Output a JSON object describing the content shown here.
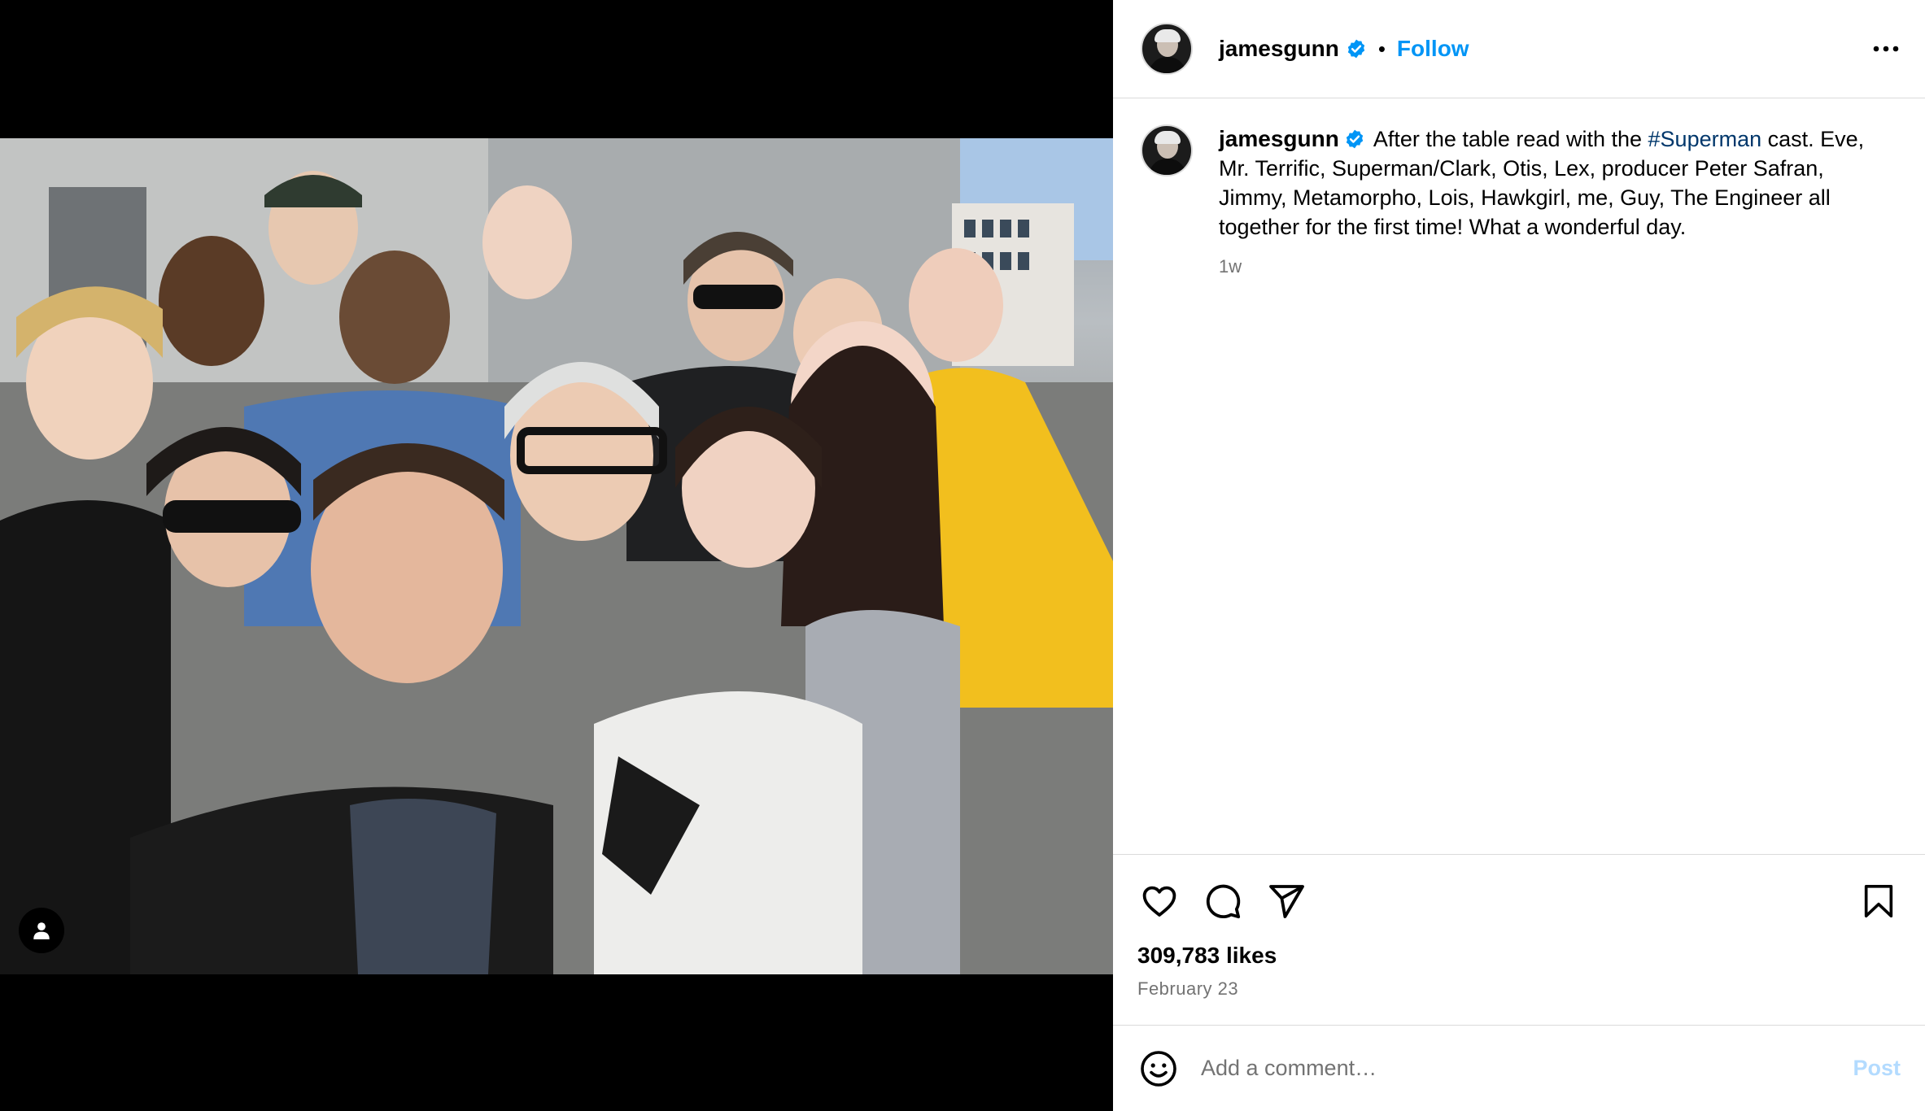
{
  "post": {
    "author": {
      "username": "jamesgunn",
      "verified": true,
      "follow_label": "Follow",
      "separator": "•"
    },
    "media": {
      "tag_icon": "person-tag-icon"
    },
    "caption": {
      "username": "jamesgunn",
      "text_before": " After the table read with the ",
      "hashtag": "#Superman",
      "text_after": " cast. Eve, Mr. Terrific, Superman/Clark, Otis, Lex, producer Peter Safran, Jimmy, Metamorpho, Lois, Hawkgirl, me, Guy, The Engineer all together for the first time! What a wonderful day.",
      "time_ago": "1w"
    },
    "stats": {
      "likes": "309,783 likes",
      "date": "February 23"
    },
    "comment": {
      "placeholder": "Add a comment…",
      "post_label": "Post"
    },
    "colors": {
      "accent": "#0095f6",
      "hashtag": "#00376b",
      "muted": "#737373",
      "divider": "#dbdbdb",
      "post_disabled": "#b3dbff"
    },
    "icons": [
      "heart-icon",
      "comment-icon",
      "share-icon",
      "bookmark-icon",
      "emoji-icon",
      "more-icon",
      "verified-icon"
    ]
  }
}
